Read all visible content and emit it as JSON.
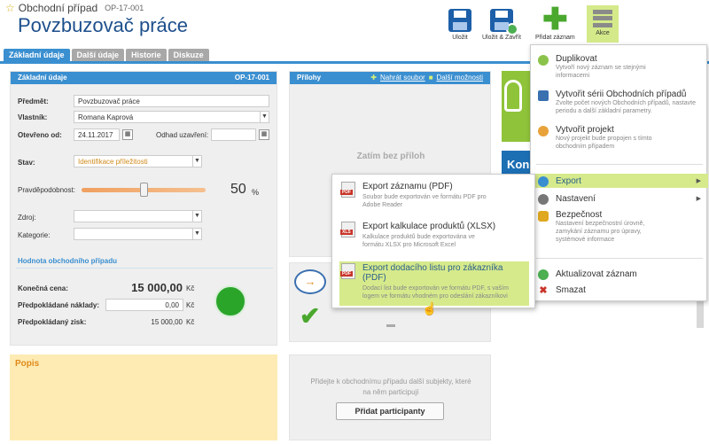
{
  "header": {
    "entity": "Obchodní případ",
    "code": "OP-17-001",
    "title": "Povzbuzovač práce"
  },
  "toolbar": {
    "save": "Uložit",
    "save_close": "Uložit & Zavřít",
    "add_record": "Přidat záznam",
    "actions": "Akce"
  },
  "tabs": [
    "Základní údaje",
    "Další údaje",
    "Historie",
    "Diskuze"
  ],
  "basic": {
    "heading": "Základní údaje",
    "code": "OP-17-001",
    "subject_label": "Předmět:",
    "subject": "Povzbuzovač práce",
    "owner_label": "Vlastník:",
    "owner": "Romana Kaprová",
    "opened_label": "Otevřeno od:",
    "opened": "24.11.2017",
    "close_est_label": "Odhad uzavření:",
    "state_label": "Stav:",
    "state": "Identifikace příležitosti",
    "prob_label": "Pravděpodobnost:",
    "prob": "50",
    "prob_unit": "%",
    "prob_value": 0.5,
    "source_label": "Zdroj:",
    "category_label": "Kategorie:",
    "value_heading": "Hodnota obchodního případu",
    "price_label": "Konečná cena:",
    "price": "15 000,00",
    "currency": "Kč",
    "cost_label": "Předpokládané náklady:",
    "cost": "0,00",
    "profit_label": "Předpokládaný zisk:",
    "profit": "15 000,00"
  },
  "attachments": {
    "heading": "Přílohy",
    "upload": "Nahrát soubor",
    "more": "Další možnosti",
    "empty": "Zatím bez příloh"
  },
  "notes": {
    "heading": "Popis"
  },
  "participants": {
    "text": "Přidejte k obchodnímu případu další subjekty, které na něm participují",
    "button": "Přidat participanty"
  },
  "right_partial": "Kon",
  "action_menu": [
    {
      "title": "Duplikovat",
      "desc": "Vytvoří nový záznam se stejnými informacemi",
      "color": "#8bc34a"
    },
    {
      "title": "Vytvořit sérii Obchodních případů",
      "desc": "Zvolte počet nových Obchodních případů, nastavte periodu a další základní parametry.",
      "color": "#3a6fb0"
    },
    {
      "title": "Vytvořit projekt",
      "desc": "Nový projekt bude propojen s tímto obchodním případem",
      "color": "#e7a23a"
    },
    {
      "title": "Export",
      "color": "#3a8fd0"
    },
    {
      "title": "Nastavení",
      "color": "#777"
    },
    {
      "title": "Bezpečnost",
      "desc": "Nastavení bezpečnostní úrovně, zamykání záznamu pro úpravy, systémové informace",
      "color": "#e0a820"
    },
    {
      "title": "Aktualizovat záznam",
      "color": "#4caf50"
    },
    {
      "title": "Smazat",
      "color": "#c9352a"
    }
  ],
  "export_menu": [
    {
      "title": "Export záznamu (PDF)",
      "desc": "Soubor bude exportován ve formátu PDF pro Adobe Reader",
      "badge": "PDF"
    },
    {
      "title": "Export kalkulace produktů (XLSX)",
      "desc": "Kalkulace produktů bude exportována ve formátu XLSX pro Microsoft Excel",
      "badge": "XLS"
    },
    {
      "title": "Export dodacího listu pro zákazníka (PDF)",
      "desc": "Dodací list bude exportován ve formátu PDF, s vaším logem ve formátu vhodném pro odeslání zákazníkovi",
      "badge": "PDF"
    }
  ]
}
